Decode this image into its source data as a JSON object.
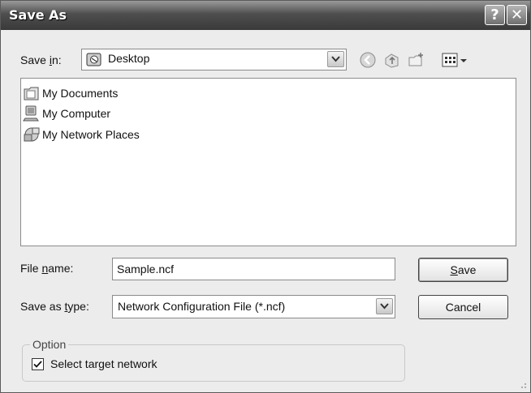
{
  "window": {
    "title": "Save As",
    "help_glyph": "?",
    "close_glyph": "✕"
  },
  "toolbar": {
    "save_in_label_prefix": "Save ",
    "save_in_label_accel": "i",
    "save_in_label_suffix": "n:",
    "location": "Desktop",
    "icons": [
      "back-icon",
      "up-folder-icon",
      "new-folder-icon",
      "view-menu-icon"
    ]
  },
  "files": [
    {
      "name": "My Documents",
      "icon": "my-documents-icon"
    },
    {
      "name": "My Computer",
      "icon": "my-computer-icon"
    },
    {
      "name": "My Network Places",
      "icon": "network-places-icon"
    }
  ],
  "file_name": {
    "label_prefix": "File ",
    "label_accel": "n",
    "label_suffix": "ame:",
    "value": "Sample.ncf"
  },
  "save_as_type": {
    "label_prefix": "Save as ",
    "label_accel": "t",
    "label_suffix": "ype:",
    "value": "Network Configuration File (*.ncf)"
  },
  "buttons": {
    "save_accel": "S",
    "save_rest": "ave",
    "cancel": "Cancel"
  },
  "option_group": {
    "title": "Option",
    "checkbox_label": "Select target network",
    "checked": true
  }
}
